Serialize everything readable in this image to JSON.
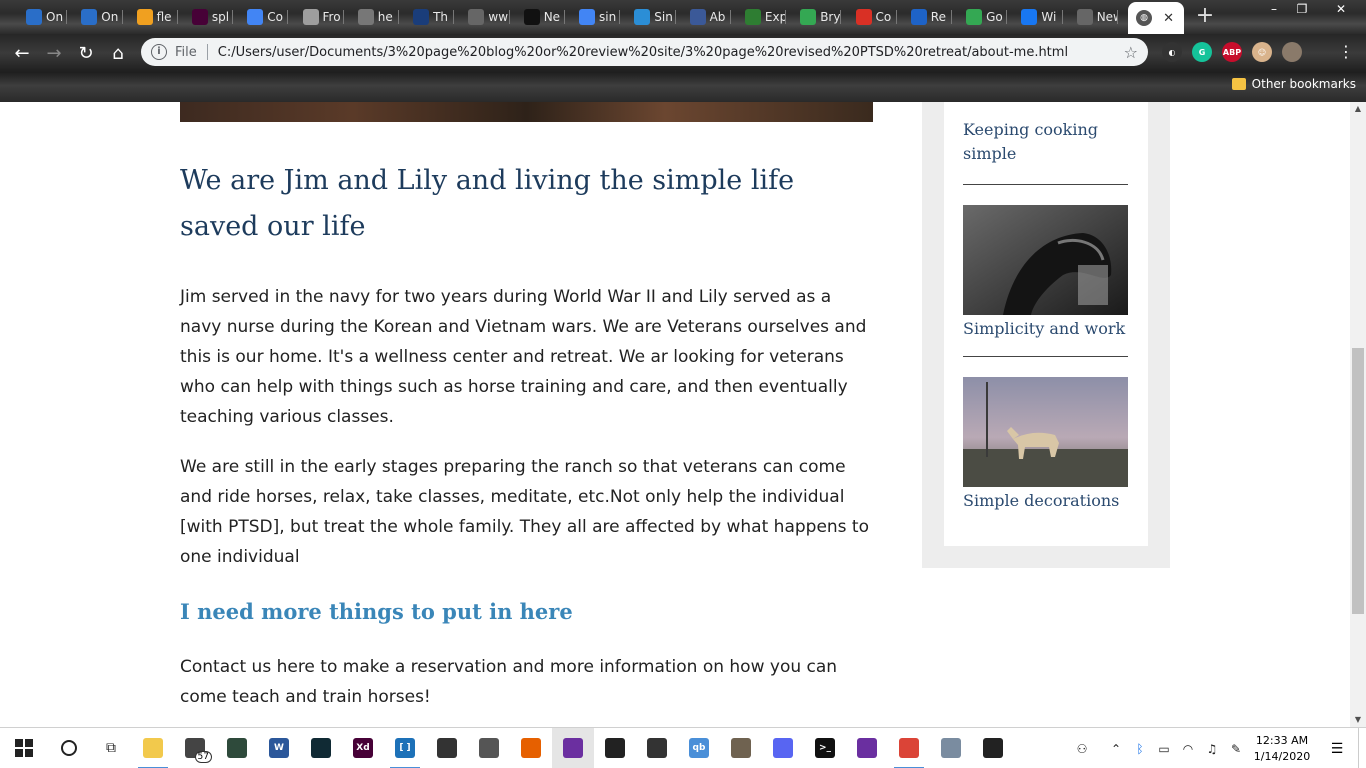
{
  "browser": {
    "tabs": [
      {
        "label": "On",
        "icon": "gem-icon",
        "color": "#2a6ec8"
      },
      {
        "label": "On",
        "icon": "gem-icon",
        "color": "#2a6ec8"
      },
      {
        "label": "fle",
        "icon": "chart-icon",
        "color": "#f0a020"
      },
      {
        "label": "spl",
        "icon": "xd-icon",
        "color": "#470137"
      },
      {
        "label": "Co",
        "icon": "docs-icon",
        "color": "#4285f4"
      },
      {
        "label": "Fro",
        "icon": "page-icon",
        "color": "#9e9e9e"
      },
      {
        "label": "he",
        "icon": "globe-icon",
        "color": "#777777"
      },
      {
        "label": "Th",
        "icon": "trend-icon",
        "color": "#1a3d7a"
      },
      {
        "label": "ww",
        "icon": "blank-icon",
        "color": "#666666"
      },
      {
        "label": "Ne",
        "icon": "rr-icon",
        "color": "#111111"
      },
      {
        "label": "sin",
        "icon": "google-icon",
        "color": "#4285f4"
      },
      {
        "label": "Sin",
        "icon": "link-icon",
        "color": "#2b8ed6"
      },
      {
        "label": "Ab",
        "icon": "seal-icon",
        "color": "#3b5998"
      },
      {
        "label": "Exp",
        "icon": "globe-icon",
        "color": "#2e7d32"
      },
      {
        "label": "Bry",
        "icon": "maps-icon",
        "color": "#34a853"
      },
      {
        "label": "Co",
        "icon": "gmail-icon",
        "color": "#d93025"
      },
      {
        "label": "Re",
        "icon": "home-icon",
        "color": "#1e63c7"
      },
      {
        "label": "Go",
        "icon": "maps-icon",
        "color": "#34a853"
      },
      {
        "label": "Wi",
        "icon": "facebook-icon",
        "color": "#1877f2"
      },
      {
        "label": "New Ta",
        "icon": "blank-icon",
        "color": "#666666"
      }
    ],
    "active_tab": {
      "label": "",
      "icon": "globe-icon"
    },
    "new_tab": "+",
    "window_controls": {
      "minimize": "–",
      "restore": "❐",
      "close": "✕"
    },
    "address": {
      "scheme_label": "File",
      "url": "C:/Users/user/Documents/3%20page%20blog%20or%20review%20site/3%20page%20revised%20PTSD%20retreat/about-me.html"
    },
    "extensions": [
      {
        "name": "contrast-icon",
        "text": "◐",
        "color": "#333333"
      },
      {
        "name": "grammarly-icon",
        "text": "G",
        "color": "#15c39a"
      },
      {
        "name": "adblock-icon",
        "text": "ABP",
        "color": "#c70d2c"
      },
      {
        "name": "extension-face-icon",
        "text": "☺",
        "color": "#d9b38c"
      },
      {
        "name": "profile-avatar-icon",
        "text": "",
        "color": "#8a7a6a"
      }
    ],
    "bookmarks": {
      "other_label": "Other bookmarks"
    }
  },
  "page": {
    "headline": "We are Jim and Lily and living the simple life saved our life",
    "paragraph1": "Jim served in the navy for two years during World War II and Lily served as a navy nurse during the Korean and Vietnam wars. We are Veterans ourselves and this is our home. It's a wellness center and retreat. We ar looking for veterans who can help with things such as horse training and care, and then eventually teaching various classes.",
    "paragraph2": "We are still in the early stages preparing the ranch so that veterans can come and ride horses, relax, take classes, meditate, etc.Not only help the individual [with PTSD], but treat the whole family. They all are affected by what happens to one individual",
    "subhead": "I need more things to put in here",
    "contact": "Contact us here to make a reservation and more information on how you can come teach and train horses!"
  },
  "sidebar": {
    "items": [
      {
        "label": "Keeping cooking simple"
      },
      {
        "label": "Simplicity and work"
      },
      {
        "label": "Simple decorations"
      }
    ]
  },
  "taskbar": {
    "apps": [
      {
        "name": "file-explorer-icon",
        "color": "#f2c94c",
        "text": "",
        "running": true
      },
      {
        "name": "store-icon",
        "color": "#444444",
        "text": "",
        "badge": "57"
      },
      {
        "name": "app-green-icon",
        "color": "#2e4a3b",
        "text": ""
      },
      {
        "name": "word-icon",
        "color": "#2b579a",
        "text": "W"
      },
      {
        "name": "dark-app-icon",
        "color": "#102a34",
        "text": ""
      },
      {
        "name": "xd-taskbar-icon",
        "color": "#470137",
        "text": "Xd"
      },
      {
        "name": "brackets-icon",
        "color": "#1d71b8",
        "text": "[ ]",
        "running": true
      },
      {
        "name": "photo-app-icon",
        "color": "#333333",
        "text": ""
      },
      {
        "name": "data-app-icon",
        "color": "#555555",
        "text": ""
      },
      {
        "name": "firefox-icon",
        "color": "#e66000",
        "text": ""
      },
      {
        "name": "chrome-canary-icon",
        "color": "#6b2fa0",
        "text": "",
        "active": true
      },
      {
        "name": "inkscape-icon",
        "color": "#222222",
        "text": ""
      },
      {
        "name": "calculator-icon",
        "color": "#333333",
        "text": ""
      },
      {
        "name": "qb-icon",
        "color": "#4a8fd8",
        "text": "qb"
      },
      {
        "name": "gimp-icon",
        "color": "#6f6250",
        "text": ""
      },
      {
        "name": "discord-icon",
        "color": "#5865f2",
        "text": ""
      },
      {
        "name": "terminal-icon",
        "color": "#111111",
        "text": ">_"
      },
      {
        "name": "podcast-icon",
        "color": "#6a2fa0",
        "text": ""
      },
      {
        "name": "chrome-icon",
        "color": "#db4437",
        "text": "",
        "running": true
      },
      {
        "name": "image-viewer-icon",
        "color": "#7a8ca0",
        "text": ""
      },
      {
        "name": "game-icon",
        "color": "#222222",
        "text": ""
      }
    ],
    "clock_time": "12:33 AM",
    "clock_date": "1/14/2020"
  }
}
